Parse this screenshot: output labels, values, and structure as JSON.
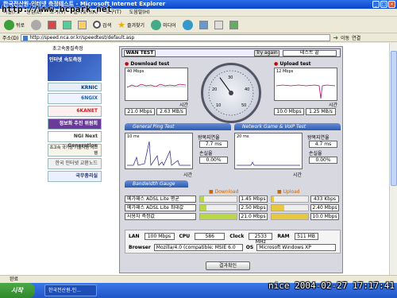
{
  "window": {
    "title": "한국전산원-인터넷 측정테스트 - Microsoft Internet Explorer"
  },
  "menu": {
    "items": [
      "파일(F)",
      "편집(E)",
      "보기(V)",
      "즐겨찾기(A)",
      "도구(T)",
      "도움말(H)"
    ]
  },
  "toolbar": {
    "back": "뒤로",
    "search": "검색",
    "favorites": "즐겨찾기",
    "media": "미디어"
  },
  "address": {
    "label": "주소(D)",
    "url": "http://speed.nca.or.kr/speedtest/default.asp",
    "go": "이동",
    "links": "연결"
  },
  "watermark": "http://www.bcpark.net",
  "leftnav": {
    "title": "초고속품질측정",
    "items": [
      "인터넷 속도측정",
      "KRNIC",
      "6NGIX",
      "6KANET",
      "정보화 추진 위원회",
      "NGI Next Generation",
      "초고속 국가망 기술지원 시스템",
      "한국 인터넷 교환노드",
      "국무총리실"
    ]
  },
  "panel": {
    "tab": "WAN TEST",
    "try_again": "Try again",
    "test_status": "테스트 끝",
    "download": {
      "title": "Download test",
      "scale": "40 Mbps",
      "time_label": "시간",
      "speed": "21.0 Mbps",
      "bytes": "2.63 MB/s"
    },
    "upload": {
      "title": "Upload test",
      "scale": "12 Mbps",
      "time_label": "시간",
      "speed": "10.0 Mbps",
      "bytes": "1.25 MB/s"
    },
    "gauge": {
      "labels": [
        "10",
        "20",
        "30",
        "40",
        "50"
      ],
      "needle_value": 21
    },
    "ping": {
      "title": "General Ping Test",
      "scale": "10 ms",
      "time_label": "시간",
      "rtt_label": "왕복지연율",
      "rtt": "7.7 ms",
      "loss_label": "손실율",
      "loss": "0.00%"
    },
    "voip": {
      "title": "Network Game & VoIP Test",
      "scale": "20 ms",
      "time_label": "시간",
      "rtt_label": "왕복지연율",
      "rtt": "4.7 ms",
      "loss_label": "손실율",
      "loss": "0.00%"
    },
    "bandwidth": {
      "title": "Bandwidth Gauge",
      "download_label": "Download",
      "upload_label": "Upload",
      "rows": [
        {
          "name": "메가패스 ADSL Lite 평균",
          "down": "1.45 Mbps",
          "up": "433 Kbps",
          "down_frac": 0.1,
          "up_frac": 0.06
        },
        {
          "name": "메가패스 ADSL Lite 최대값",
          "down": "2.50 Mbps",
          "up": "2.40 Mbps",
          "down_frac": 0.18,
          "up_frac": 0.34
        },
        {
          "name": "사용자 측정값",
          "down": "21.0 Mbps",
          "up": "10.0 Mbps",
          "down_frac": 1.0,
          "up_frac": 1.0
        }
      ]
    },
    "system": {
      "lan_label": "LAN",
      "lan": "100 Mbps",
      "cpu_label": "CPU",
      "cpu": "586",
      "clock_label": "Clock",
      "clock": "2533 MHz",
      "ram_label": "RAM",
      "ram": "511 MB",
      "browser_label": "Browser",
      "browser": "Mozilla/4.0 (compatible; MSIE 6.0",
      "os_label": "OS",
      "os": "Microsoft Windows XP"
    },
    "result_button": "결과확인"
  },
  "statusbar": {
    "text": "완료"
  },
  "taskbar": {
    "start": "시작",
    "item": "한국전산원-인..."
  },
  "stamp": "nice 2004-02-27 17:17:41",
  "colors": {
    "panel_header": "#2a5db0",
    "download_bar": "#b8d84a",
    "upload_bar": "#e8c840",
    "titlebar": "#0a46c8"
  }
}
